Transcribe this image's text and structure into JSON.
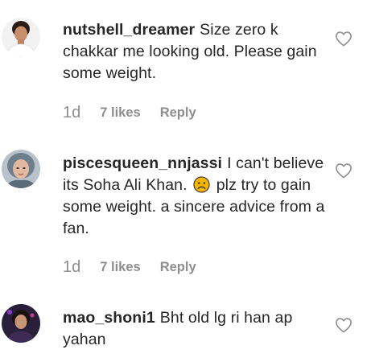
{
  "comments": [
    {
      "username": "nutshell_dreamer",
      "text": "Size zero k chakkar me looking old. Please gain some weight.",
      "time": "1d",
      "likes": "7 likes",
      "reply": "Reply",
      "avatar_icon": "avatar-woman-white-top",
      "heart_icon": "heart-outline-icon"
    },
    {
      "username": "piscesqueen_nnjassi",
      "text_before": "I can't believe its Soha Ali Khan.",
      "emoji": "sad-face-emoji",
      "text_after": "plz try to gain some weight. a sincere advice from a fan.",
      "time": "1d",
      "likes": "7 likes",
      "reply": "Reply",
      "avatar_icon": "avatar-illustrated-face",
      "heart_icon": "heart-outline-icon"
    },
    {
      "username": "mao_shoni1",
      "text": "Bht old lg ri han ap yahan",
      "avatar_icon": "avatar-woman-dark-photo",
      "heart_icon": "heart-outline-icon"
    }
  ],
  "colors": {
    "primary_text": "#262626",
    "secondary_text": "#8e8e8e",
    "heart_stroke": "#8e8e8e",
    "emoji_yellow": "#f5b400"
  }
}
